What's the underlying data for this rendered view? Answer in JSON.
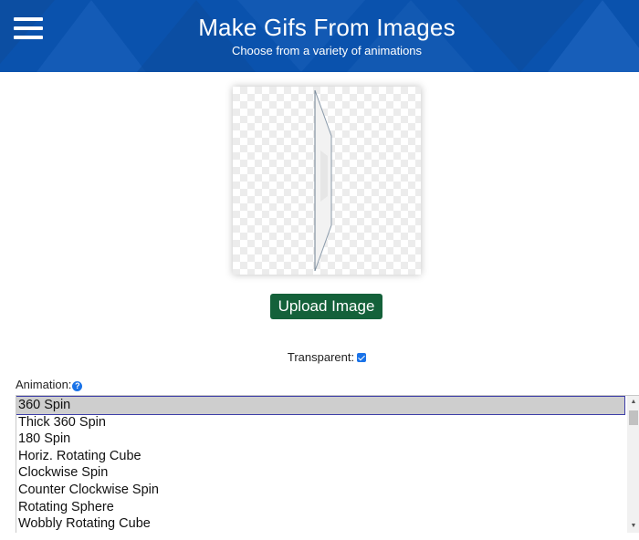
{
  "header": {
    "title": "Make Gifs From Images",
    "subtitle": "Choose from a variety of animations",
    "menu_icon": "hamburger-menu-icon",
    "bg_color": "#0a52ad"
  },
  "upload": {
    "label": "Upload Image",
    "color": "#14613a"
  },
  "transparent": {
    "label": "Transparent:",
    "checked": true
  },
  "animation": {
    "label": "Animation:",
    "help_glyph": "?",
    "selected": "360 Spin",
    "items": [
      "360 Spin",
      "Thick 360 Spin",
      "180 Spin",
      "Horiz. Rotating Cube",
      "Clockwise Spin",
      "Counter Clockwise Spin",
      "Rotating Sphere",
      "Wobbly Rotating Cube"
    ]
  }
}
